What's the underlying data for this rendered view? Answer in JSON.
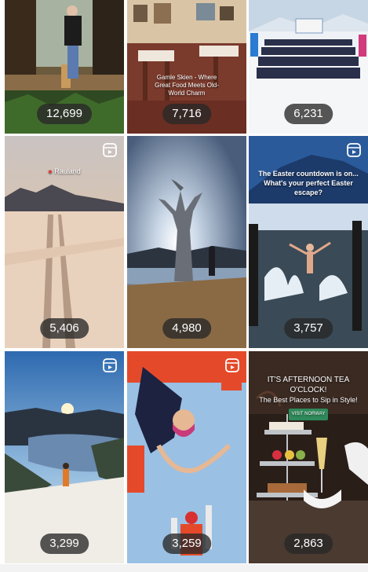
{
  "tiles": [
    {
      "count": "12,699"
    },
    {
      "count": "7,716",
      "caption": "Gamle Skien - Where Great Food Meets Old-World Charm"
    },
    {
      "count": "6,231"
    },
    {
      "count": "5,406",
      "location": "Rauland"
    },
    {
      "count": "4,980"
    },
    {
      "count": "3,757",
      "caption_line1": "The Easter countdown is on...",
      "caption_line2": "What's your perfect Easter escape?"
    },
    {
      "count": "3,299"
    },
    {
      "count": "3,259"
    },
    {
      "count": "2,863",
      "title": "IT'S AFTERNOON TEA O'CLOCK!",
      "subtitle": "The Best Places to Sip in Style!",
      "tag": "VISIT NORWAY"
    }
  ],
  "colors": {
    "count_bg": "#282828",
    "accent_red": "#e53935"
  }
}
